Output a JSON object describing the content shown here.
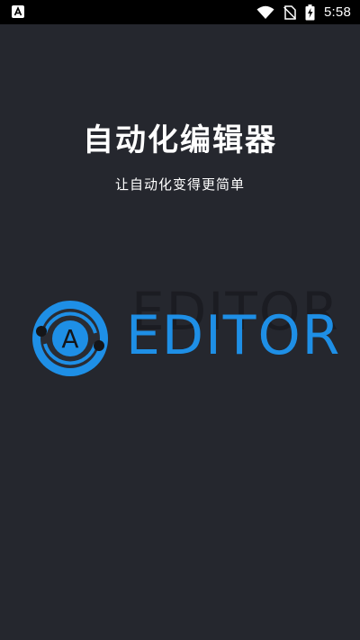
{
  "status_bar": {
    "time": "5:58",
    "left_icon": "app-notification-icon",
    "icons": [
      "wifi-icon",
      "no-sim-icon",
      "battery-charging-icon"
    ]
  },
  "splash": {
    "title": "自动化编辑器",
    "subtitle": "让自动化变得更简单",
    "logo_letter": "A",
    "logo_word": "EDITOR",
    "colors": {
      "background": "#25272e",
      "brand_blue": "#1e8fe6",
      "status_bar": "#000000"
    }
  }
}
